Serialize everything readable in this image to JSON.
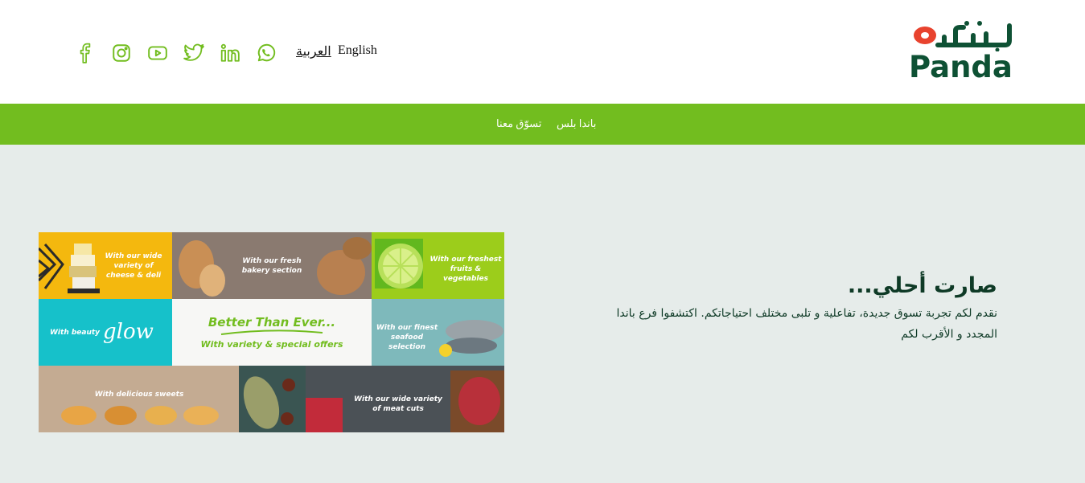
{
  "header": {
    "logo": {
      "arabic": "بنده",
      "latin": "Panda"
    },
    "languages": {
      "arabic": "العربية",
      "english": "English"
    },
    "social": [
      "facebook-icon",
      "instagram-icon",
      "youtube-icon",
      "twitter-icon",
      "linkedin-icon",
      "whatsapp-icon"
    ]
  },
  "nav": {
    "items": [
      "باندا بلس",
      "تسوّق معنا"
    ]
  },
  "banner": {
    "tiles": [
      "With our wide variety of cheese & deli",
      "With our fresh bakery section",
      "With our freshest fruits & vegetables",
      "With beauty",
      "glow",
      "Better Than Ever...",
      "With variety & special offers",
      "With our finest seafood selection",
      "With delicious sweets",
      "With our wide variety of meat cuts"
    ]
  },
  "hero": {
    "title": "صارت أحلي...",
    "body": "نقدم لكم تجربة تسوق جديدة، تفاعلية و تلبى مختلف احتياجاتكم. اكتشفوا فرع باندا المجدد و الأقرب لكم"
  },
  "colors": {
    "brand_green": "#72bd1f",
    "dark_green": "#0e5134",
    "logo_red": "#e8432e",
    "background": "#e6ecea"
  }
}
